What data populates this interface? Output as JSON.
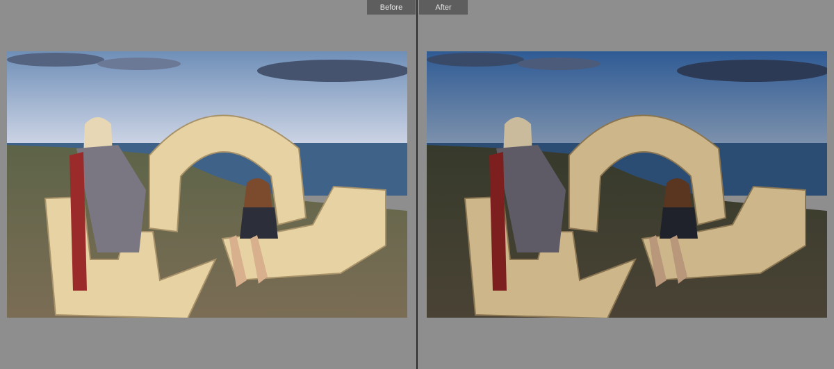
{
  "compare_view": {
    "before_label": "Before",
    "after_label": "After"
  },
  "photo": {
    "subject": "two-women-stone-arch-seaside",
    "before_palette": {
      "sky_top": "#6f8fb8",
      "sky_bottom": "#cfd6e6",
      "sea": "#3f6289",
      "ground": "#6b6a4f",
      "stone": "#e7d2a3"
    },
    "after_palette": {
      "sky_top": "#2f5b95",
      "sky_bottom": "#7f93ad",
      "sea": "#2b4d74",
      "ground": "#403f31",
      "stone": "#cdb78a"
    }
  }
}
